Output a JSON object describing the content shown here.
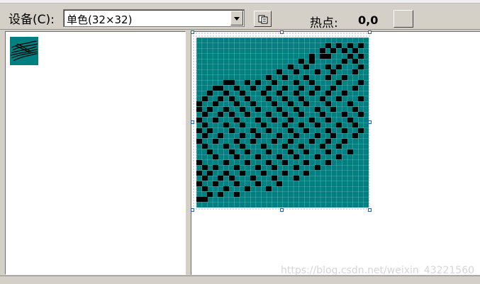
{
  "toolbar": {
    "device_label": "设备(C):",
    "device_value": "单色(32×32)",
    "hotspot_label": "热点:",
    "hotspot_value": "0,0"
  },
  "icons": {
    "dropdown": "chevron-down-icon",
    "copy": "copy-icon",
    "thumb": "icon-thumbnail",
    "editor": "pixel-editor-canvas"
  },
  "colors": {
    "background": "#d4d0c8",
    "canvas": "#008080",
    "pixel": "#000000",
    "grid": "#b8b8b8",
    "selection": "#1f5fbf"
  },
  "watermark": "https://blog.csdn.net/weixin_43221560"
}
